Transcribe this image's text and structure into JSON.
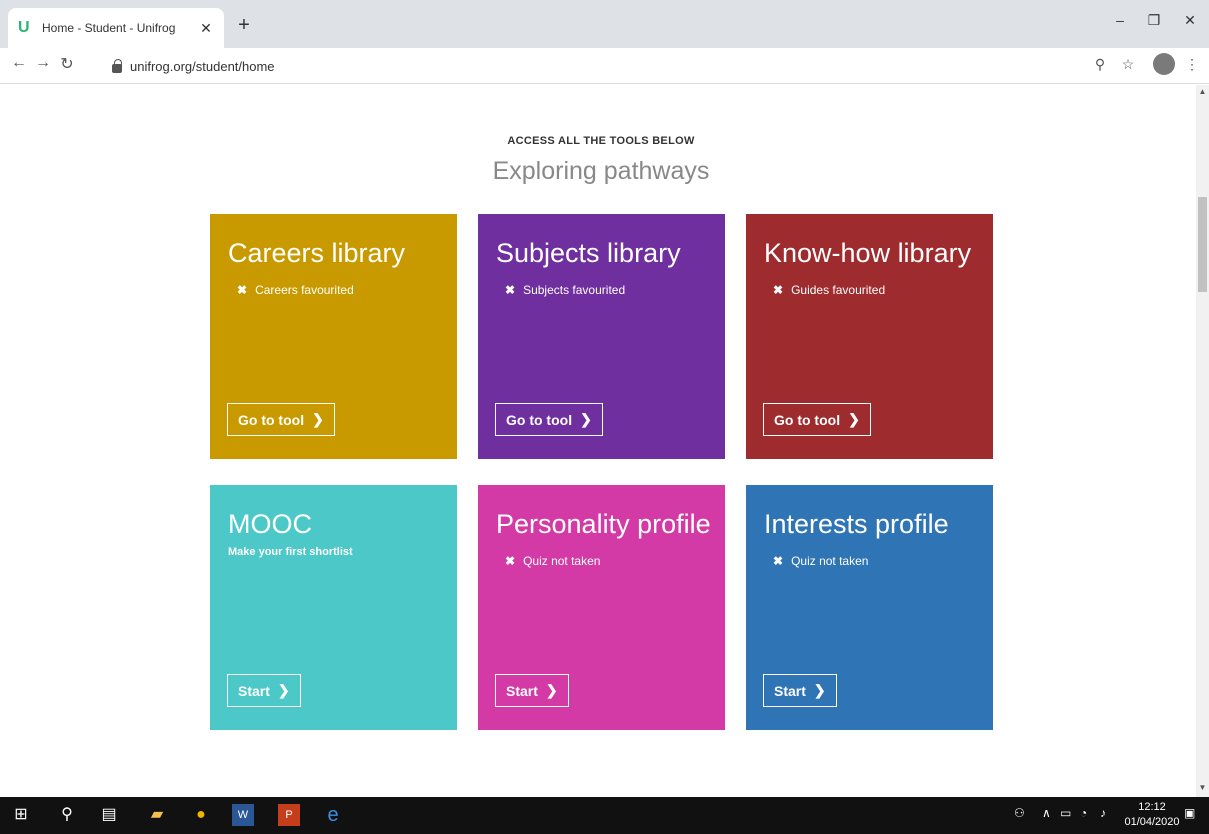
{
  "browser": {
    "tab_title": "Home - Student - Unifrog",
    "favicon": "U",
    "url": "unifrog.org/student/home"
  },
  "page": {
    "eyebrow": "ACCESS ALL THE TOOLS BELOW",
    "title": "Exploring pathways"
  },
  "cards": [
    {
      "title": "Careers library",
      "status": "Careers favourited",
      "button": "Go to tool",
      "color": "#c99a00"
    },
    {
      "title": "Subjects library",
      "status": "Subjects favourited",
      "button": "Go to tool",
      "color": "#6f2f9f"
    },
    {
      "title": "Know-how library",
      "status": "Guides favourited",
      "button": "Go to tool",
      "color": "#9e2b2d"
    },
    {
      "title": "MOOC",
      "subtitle": "Make your first shortlist",
      "button": "Start",
      "color": "#4dc8c8"
    },
    {
      "title": "Personality profile",
      "status": "Quiz not taken",
      "button": "Start",
      "color": "#d43aa6"
    },
    {
      "title": "Interests profile",
      "status": "Quiz not taken",
      "button": "Start",
      "color": "#2f74b5"
    }
  ],
  "taskbar": {
    "time": "12:12",
    "date": "01/04/2020"
  }
}
